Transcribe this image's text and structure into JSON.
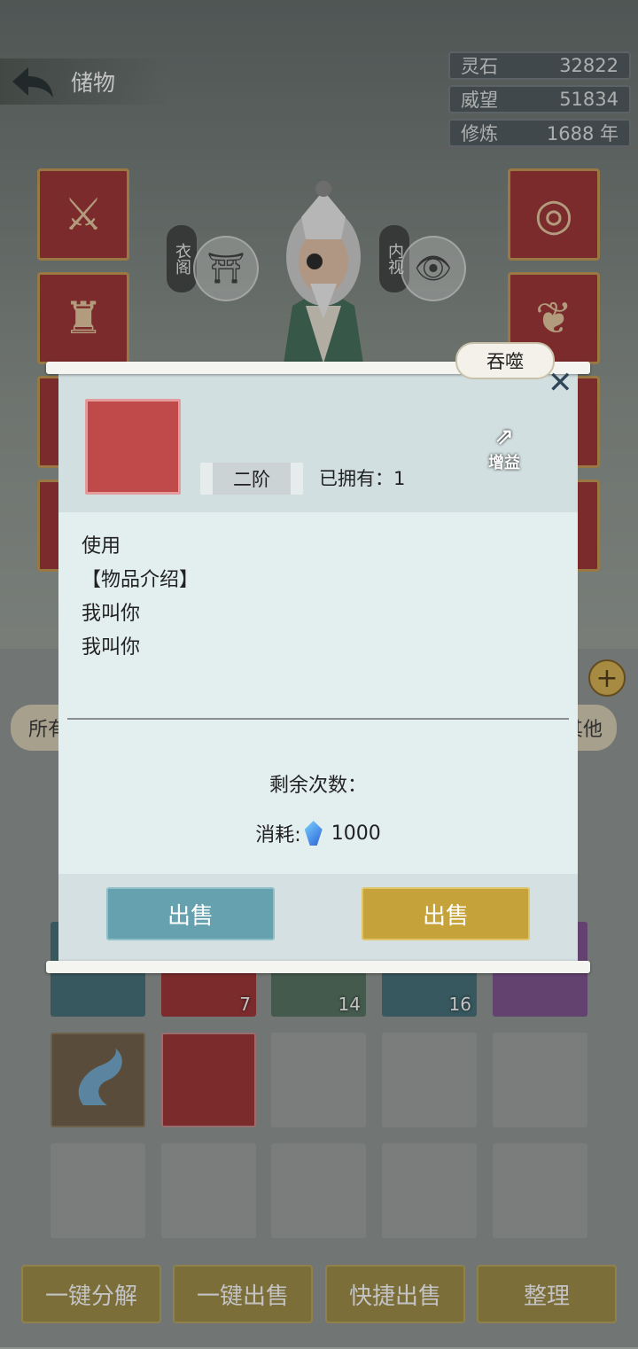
{
  "header": {
    "back_label": "储物"
  },
  "stats": [
    {
      "name": "灵石",
      "value": "32822"
    },
    {
      "name": "威望",
      "value": "51834"
    },
    {
      "name": "修炼",
      "value": "1688 年"
    }
  ],
  "character": {
    "wardrobe_label": "衣阁",
    "inner_view_label": "内视"
  },
  "tabs": {
    "all_label": "所有",
    "other_label": "其他"
  },
  "bag": {
    "counts": [
      "7",
      "14",
      "16"
    ]
  },
  "bottom_actions": [
    "一键分解",
    "一键出售",
    "快捷出售",
    "整理"
  ],
  "dialog": {
    "devour_label": "吞噬",
    "tier": "二阶",
    "owned": "已拥有：1",
    "boost_label": "增益",
    "desc_lines": [
      "使用",
      "【物品介绍】",
      "我叫你",
      "我叫你"
    ],
    "remaining": "剩余次数：",
    "cost_label": "消耗:",
    "cost_value": "1000",
    "sell_left": "出售",
    "sell_right": "出售"
  }
}
